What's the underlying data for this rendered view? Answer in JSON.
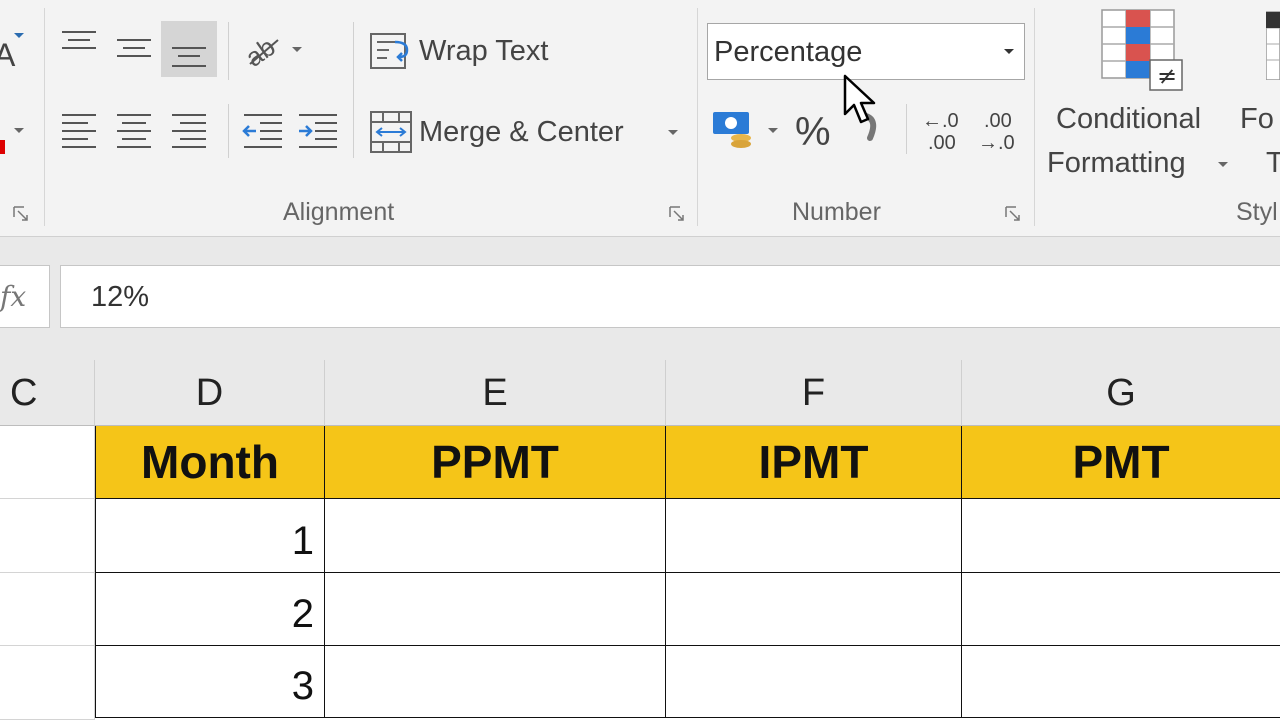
{
  "ribbon": {
    "alignment": {
      "wrap_text_label": "Wrap Text",
      "merge_center_label": "Merge & Center",
      "group_label": "Alignment"
    },
    "number": {
      "format_value": "Percentage",
      "percent_label": "%",
      "increase_decimal_top": "←.0",
      "increase_decimal_bottom": ".00",
      "decrease_decimal_top": ".00",
      "decrease_decimal_bottom": "→.0",
      "group_label": "Number"
    },
    "styles": {
      "conditional_formatting_line1": "Conditional",
      "conditional_formatting_line2": "Formatting",
      "format_as_table_line1": "Fo",
      "format_as_table_line2": "T",
      "group_label": "Styl"
    }
  },
  "formula_bar": {
    "fx_label": "fx",
    "value": "12%"
  },
  "grid": {
    "columns": [
      "C",
      "D",
      "E",
      "F",
      "G"
    ],
    "table_headers": [
      "Month",
      "PPMT",
      "IPMT",
      "PMT"
    ],
    "months": [
      "1",
      "2",
      "3"
    ]
  },
  "colors": {
    "header_fill": "#f5c518",
    "ribbon_bg": "#f3f3f3"
  }
}
